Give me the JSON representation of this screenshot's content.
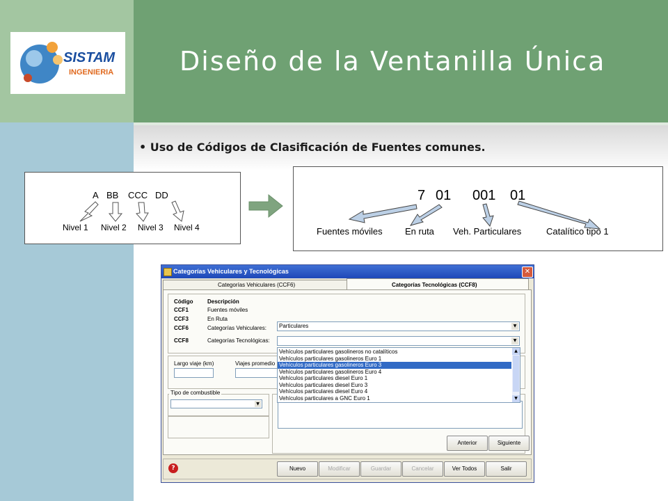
{
  "slide": {
    "title": "Diseño de la Ventanilla Única",
    "bullet": "Uso de Códigos de Clasificación de Fuentes comunes.",
    "logo": {
      "main": "SISTAM",
      "sub": "INGENIERIA"
    }
  },
  "left_diagram": {
    "code_parts": [
      "A",
      "BB",
      "CCC",
      "DD"
    ],
    "levels": [
      "Nivel 1",
      "Nivel 2",
      "Nivel 3",
      "Nivel 4"
    ]
  },
  "right_diagram": {
    "code_parts": [
      "7",
      "01",
      "001",
      "01"
    ],
    "labels": [
      "Fuentes móviles",
      "En ruta",
      "Veh. Particulares",
      "Catalítico tipo 1"
    ]
  },
  "window": {
    "title": "Categorías Vehiculares y Tecnológicas",
    "tabs": [
      "Categorías Vehiculares (CCF6)",
      "Categorías Tecnológicas (CCF8)"
    ],
    "header_code": "Código",
    "header_desc": "Descripción",
    "rows": [
      {
        "code": "CCF1",
        "desc": "Fuentes móviles"
      },
      {
        "code": "CCF3",
        "desc": "En Ruta"
      },
      {
        "code": "CCF6",
        "desc": "Categorías Vehiculares:"
      },
      {
        "code": "CCF8",
        "desc": "Categorías Tecnológicas:"
      }
    ],
    "ccf6_selected": "Particulares",
    "dropdown_options": [
      "Vehículos particulares gasolineros no catalíticos",
      "Vehículos particulares gasolineros Euro 1",
      "Vehículos particulares gasolineros Euro 3",
      "Vehículos particulares gasolineros Euro 4",
      "Vehículos particulares diesel Euro 1",
      "Vehículos particulares diesel Euro 3",
      "Vehículos particulares diesel Euro 4",
      "Vehículos particulares a GNC Euro 1"
    ],
    "highlighted_option": "Vehículos particulares gasolineros Euro 3",
    "labels": {
      "largo": "Largo viaje (km)",
      "viajes": "Viajes promedio",
      "combustible": "Tipo de combustible"
    },
    "nav_buttons": [
      "Anterior",
      "Siguiente"
    ],
    "toolbar": [
      "Nuevo",
      "Modificar",
      "Guardar",
      "Cancelar",
      "Ver Todos",
      "Salir"
    ]
  },
  "colors": {
    "title_band": "#6fa173",
    "left_top": "#a3c6a1",
    "left_bottom": "#a6c9d7",
    "arrow": "#7fa47f",
    "selection": "#316ac5"
  }
}
